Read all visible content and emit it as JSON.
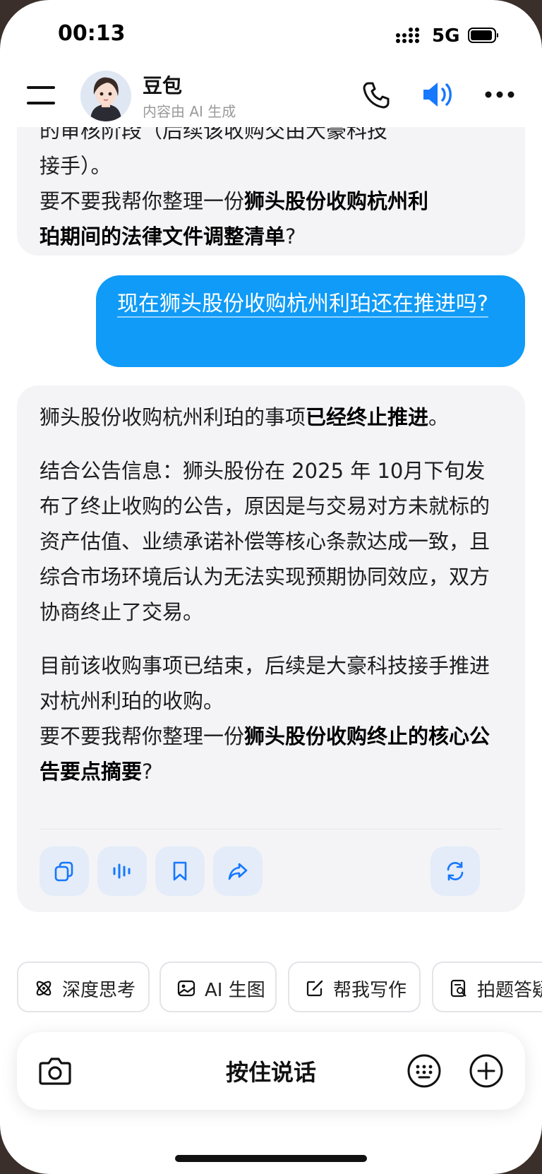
{
  "status_bar": {
    "time": "00:13",
    "network": "5G"
  },
  "header": {
    "bot_name": "豆包",
    "subtitle": "内容由 AI 生成"
  },
  "messages": {
    "ai1": {
      "line_cut": "的审核阶段（后续该收购交由大豪科技",
      "l1": "接手）。",
      "l2a": "要不要我帮你整理一份",
      "l2b": "狮头股份收购杭州利",
      "l3b": "珀期间的法律文件调整清单",
      "l3c": "?"
    },
    "user": {
      "text": "现在狮头股份收购杭州利珀还在推进吗?"
    },
    "ai2": {
      "p1a": "狮头股份收购杭州利珀的事项",
      "p1b": "已经终止推进",
      "p1c": "。",
      "p2": "结合公告信息：狮头股份在 2025 年 10月下旬发布了终止收购的公告，原因是与交易对方未就标的资产估值、业绩承诺补偿等核心条款达成一致，且综合市场环境后认为无法实现预期协同效应，双方协商终止了交易。",
      "p3": "目前该收购事项已结束，后续是大豪科技接手推进对杭州利珀的收购。",
      "p4a": "要不要我帮你整理一份",
      "p4b": "狮头股份收购终止的核心公告要点摘要",
      "p4c": "?"
    }
  },
  "chips": [
    "深度思考",
    "AI 生图",
    "帮我写作",
    "拍题答疑"
  ],
  "input": {
    "hold_to_talk": "按住说话"
  },
  "colors": {
    "accent": "#0f9bf7",
    "bubble_ai": "#f4f4f6",
    "action_bg": "#e3ecf8"
  }
}
